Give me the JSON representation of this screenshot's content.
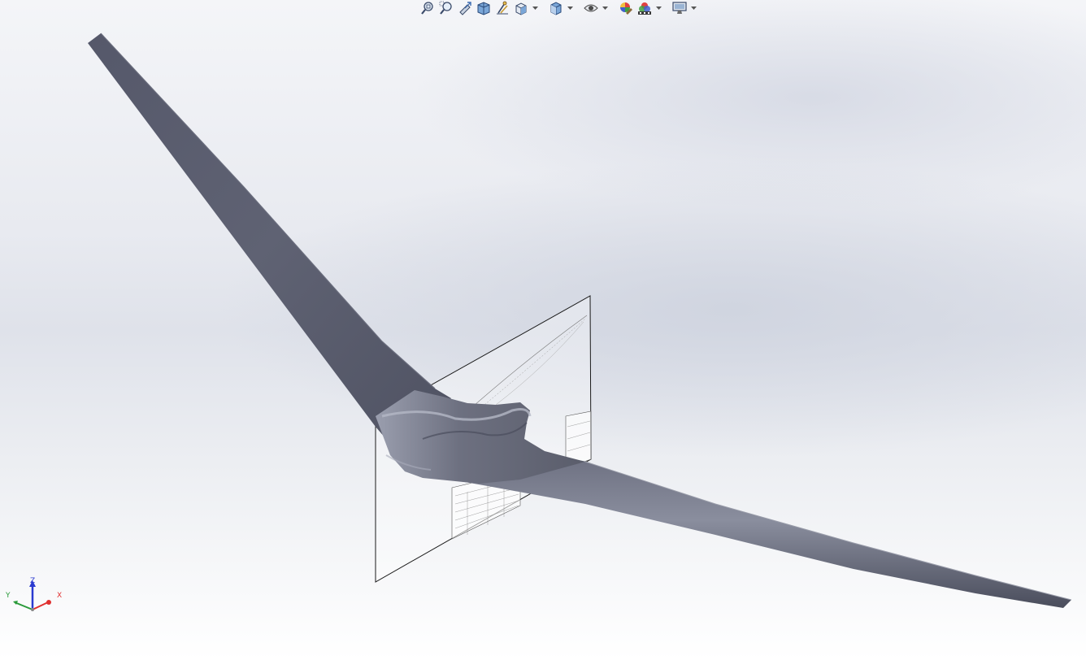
{
  "toolbar": {
    "items": [
      {
        "icon": "zoom-to-fit-icon"
      },
      {
        "icon": "zoom-to-area-icon"
      },
      {
        "icon": "previous-view-icon"
      },
      {
        "icon": "section-view-icon"
      },
      {
        "icon": "dynamic-annotation-views-icon"
      },
      {
        "icon": "view-orientation-icon",
        "dropdown": true
      },
      {
        "icon": "display-style-icon",
        "dropdown": true
      },
      {
        "icon": "hide-show-items-icon",
        "dropdown": true
      },
      {
        "icon": "edit-appearance-icon"
      },
      {
        "icon": "apply-scene-icon",
        "dropdown": true
      },
      {
        "icon": "view-settings-icon",
        "dropdown": true
      }
    ]
  },
  "triad": {
    "x_label": "X",
    "y_label": "Y",
    "z_label": "Z",
    "x_color": "#e03030",
    "y_color": "#2a9a3a",
    "z_color": "#2a3ad0"
  },
  "model": {
    "body_color": "#5a5d6b",
    "highlight_color": "#8a8e9e"
  }
}
